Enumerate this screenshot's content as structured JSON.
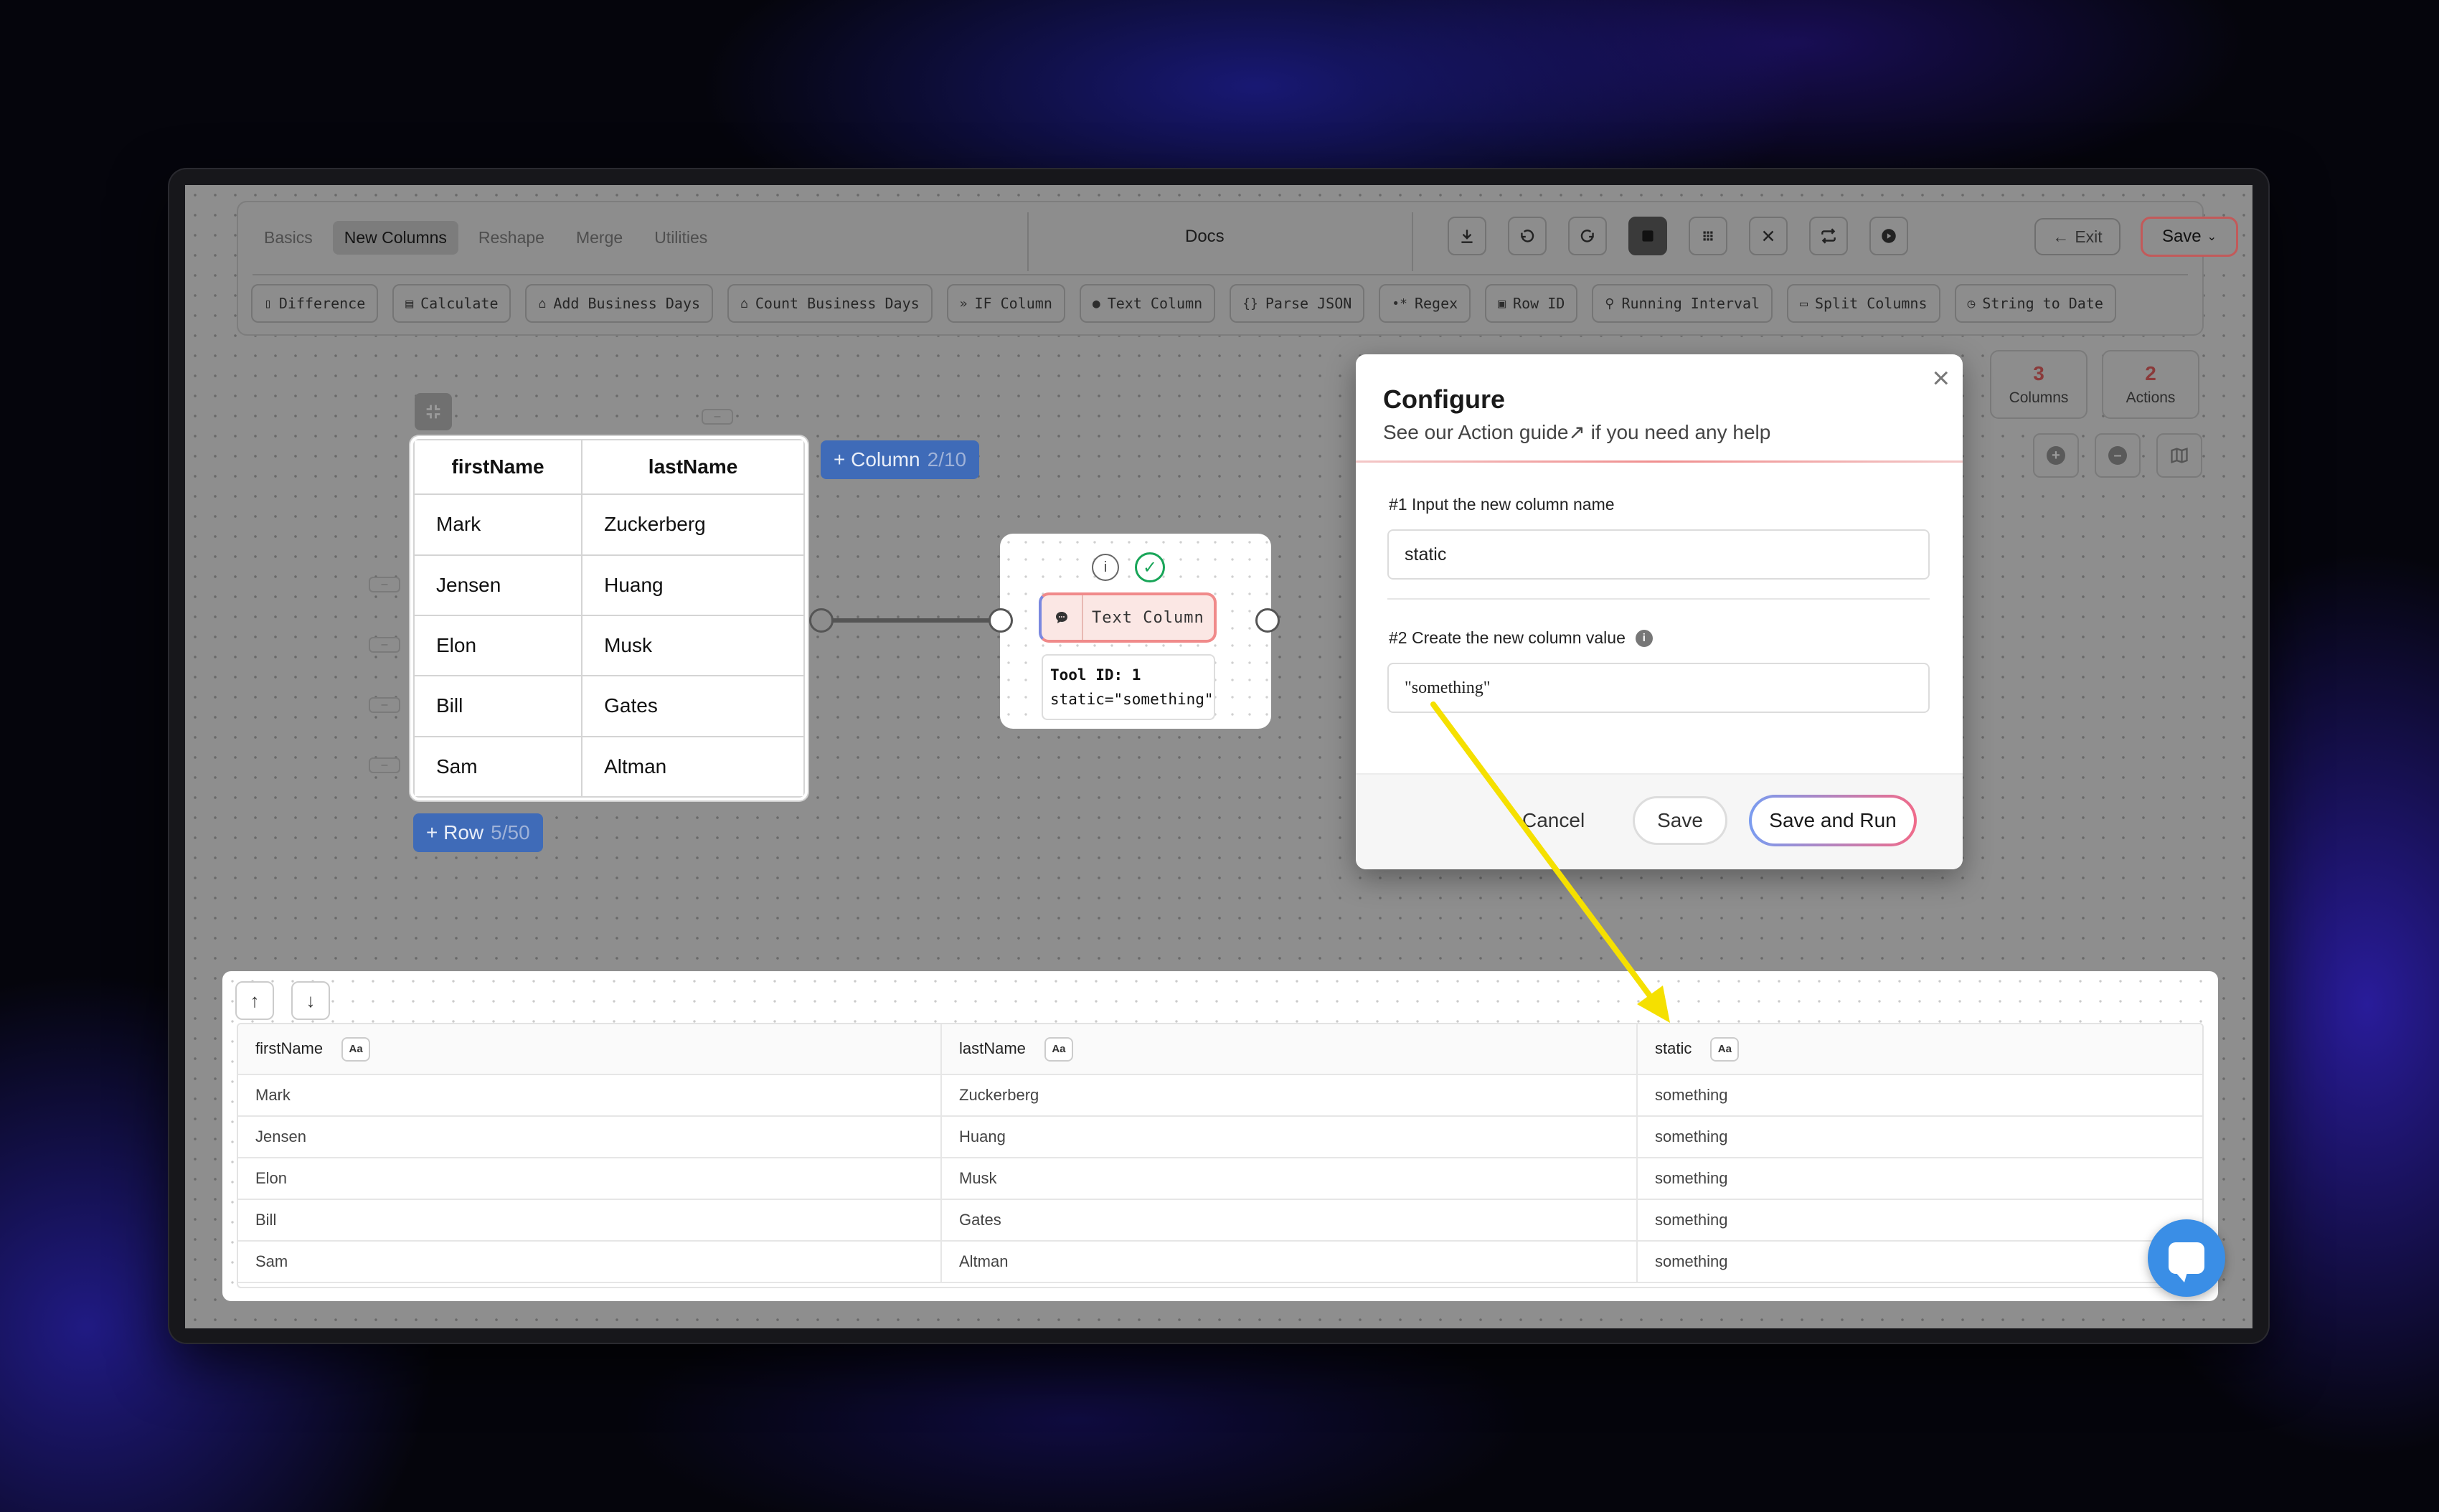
{
  "toolbar": {
    "tabs": [
      {
        "label": "Basics"
      },
      {
        "label": "New Columns",
        "active": true
      },
      {
        "label": "Reshape"
      },
      {
        "label": "Merge"
      },
      {
        "label": "Utilities"
      }
    ],
    "docs_label": "Docs",
    "exit_label": "Exit",
    "save_label": "Save",
    "save_border_color": "#c25a5a",
    "actions": [
      {
        "label": "Difference",
        "icon": "file-icon"
      },
      {
        "label": "Calculate",
        "icon": "calculator-icon"
      },
      {
        "label": "Add Business Days",
        "icon": "briefcase-icon"
      },
      {
        "label": "Count Business Days",
        "icon": "briefcase-icon"
      },
      {
        "label": "IF Column",
        "icon": "chevrons-right-icon"
      },
      {
        "label": "Text Column",
        "icon": "chat-icon"
      },
      {
        "label": "Parse JSON",
        "icon": "braces-icon"
      },
      {
        "label": "Regex",
        "icon": "regex-icon"
      },
      {
        "label": "Row ID",
        "icon": "id-card-icon"
      },
      {
        "label": "Running Interval",
        "icon": "running-icon"
      },
      {
        "label": "Split Columns",
        "icon": "split-icon"
      },
      {
        "label": "String to Date",
        "icon": "clock-icon"
      }
    ]
  },
  "source_table": {
    "headers": [
      "firstName",
      "lastName"
    ],
    "rows": [
      [
        "Mark",
        "Zuckerberg"
      ],
      [
        "Jensen",
        "Huang"
      ],
      [
        "Elon",
        "Musk"
      ],
      [
        "Bill",
        "Gates"
      ],
      [
        "Sam",
        "Altman"
      ]
    ],
    "add_column": {
      "label": "+ Column",
      "count": "2/10"
    },
    "add_row": {
      "label": "+ Row",
      "count": "5/50"
    }
  },
  "tool_node": {
    "label": "Text Column",
    "tool_id_line": "Tool ID: 1",
    "expression_line": "static=\"something\""
  },
  "stats": {
    "columns": {
      "value": "3",
      "label": "Columns"
    },
    "actions": {
      "value": "2",
      "label": "Actions"
    }
  },
  "modal": {
    "title": "Configure",
    "subtitle_prefix": "See our ",
    "subtitle_link": "Action guide",
    "subtitle_suffix": " if you need any help",
    "field1": {
      "label": "#1 Input the new column name",
      "value": "static"
    },
    "field2": {
      "label": "#2 Create the new column value",
      "value": "\"something\""
    },
    "buttons": {
      "cancel": "Cancel",
      "save": "Save",
      "save_and_run": "Save and Run"
    }
  },
  "result_grid": {
    "headers": [
      "firstName",
      "lastName",
      "static"
    ],
    "type_badge": "Aa",
    "rows": [
      [
        "Mark",
        "Zuckerberg",
        "something"
      ],
      [
        "Jensen",
        "Huang",
        "something"
      ],
      [
        "Elon",
        "Musk",
        "something"
      ],
      [
        "Bill",
        "Gates",
        "something"
      ],
      [
        "Sam",
        "Altman",
        "something"
      ]
    ]
  },
  "colors": {
    "annotation_arrow": "#f5e000",
    "success": "#18a558",
    "primary_blue": "#3f6bb8"
  }
}
